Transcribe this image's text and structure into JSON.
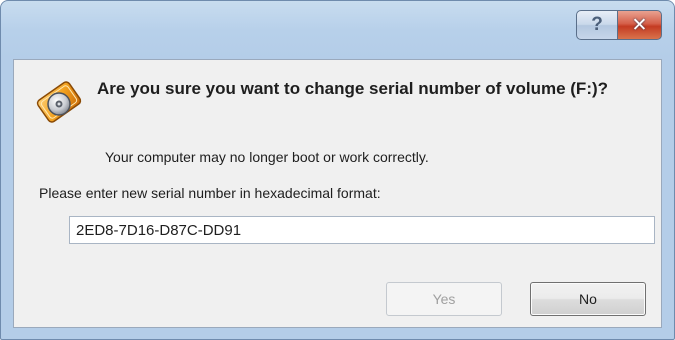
{
  "window": {
    "help_label": "?",
    "close_label": "✕"
  },
  "dialog": {
    "icon": "volume-serial-warning-icon",
    "heading": "Are you sure you want to change serial number of volume (F:)?",
    "warning": "Your computer may no longer boot or work correctly.",
    "prompt": "Please enter new serial number in hexadecimal format:",
    "serial_value": "2ED8-7D16-D87C-DD91"
  },
  "buttons": {
    "yes_label": "Yes",
    "no_label": "No"
  },
  "colors": {
    "frame": "#b4cde8",
    "close_button": "#c43b22",
    "client_bg": "#f0f0f0"
  }
}
